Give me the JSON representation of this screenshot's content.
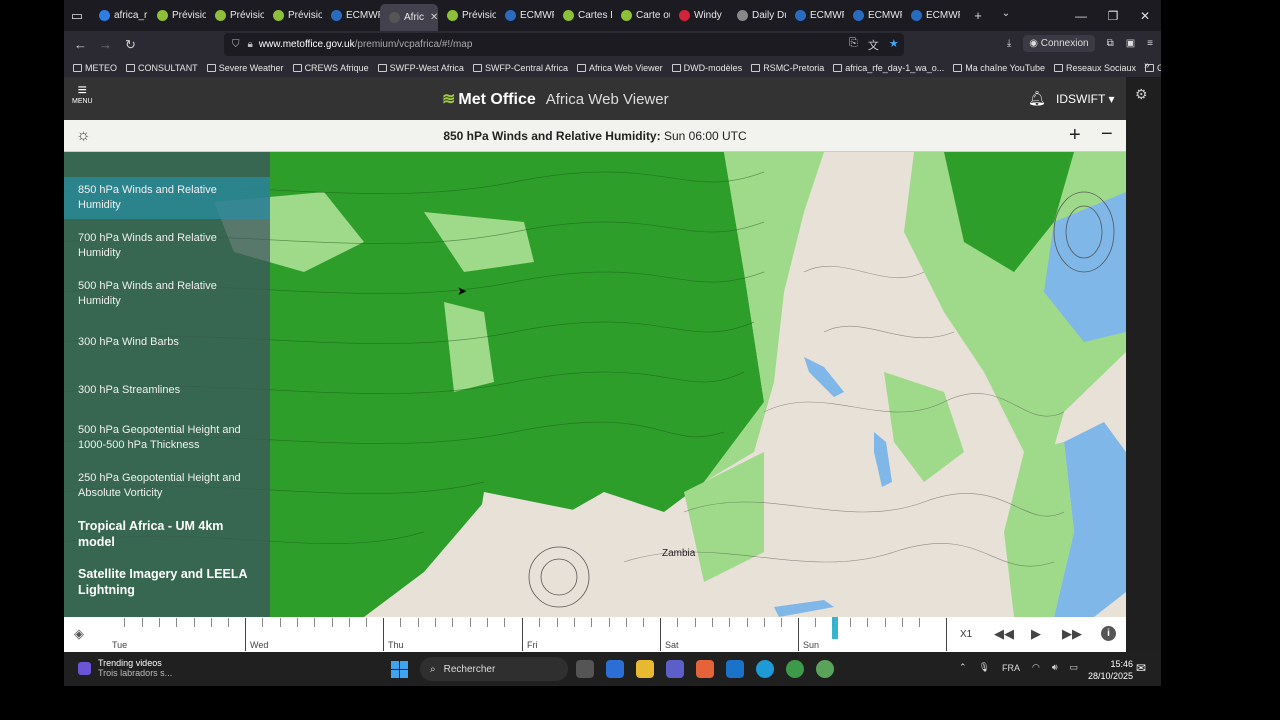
{
  "browser": {
    "tabs": [
      {
        "label": "africa_r",
        "color": "#2e7de0"
      },
      {
        "label": "Prévisio",
        "color": "#8fbf3a"
      },
      {
        "label": "Prévisio",
        "color": "#8fbf3a"
      },
      {
        "label": "Prévisio",
        "color": "#8fbf3a"
      },
      {
        "label": "ECMWF",
        "color": "#2a6bbd"
      },
      {
        "label": "Afric",
        "color": "#555555"
      },
      {
        "label": "Prévisio",
        "color": "#8fbf3a"
      },
      {
        "label": "ECMWF",
        "color": "#2a6bbd"
      },
      {
        "label": "Cartes P",
        "color": "#8fbf3a"
      },
      {
        "label": "Carte ou",
        "color": "#8fbf3a"
      },
      {
        "label": "Windy",
        "color": "#d0243b"
      },
      {
        "label": "Daily Du",
        "color": "#888888"
      },
      {
        "label": "ECMWF",
        "color": "#2a6bbd"
      },
      {
        "label": "ECMWF",
        "color": "#2a6bbd"
      },
      {
        "label": "ECMWF",
        "color": "#2a6bbd"
      }
    ],
    "active_tab_index": 5,
    "url_host": "www.metoffice.gov.uk",
    "url_path": "/premium/vcpafrica/#!/map",
    "account_label": "Connexion",
    "bookmarks": [
      "METEO",
      "CONSULTANT",
      "Severe Weather",
      "CREWS Afrique",
      "SWFP-West Africa",
      "SWFP-Central Africa",
      "Africa Web Viewer",
      "DWD-modèles",
      "RSMC-Pretoria",
      "africa_rfe_day-1_wa_o...",
      "Ma chaîne YouTube",
      "Reseaux Sociaux",
      "Goog Trad"
    ]
  },
  "app": {
    "menu_label": "MENU",
    "brand_name": "Met Office",
    "brand_subtitle": "Africa Web Viewer",
    "user_name": "IDSWIFT",
    "map_title_bold": "850 hPa Winds and Relative Humidity:",
    "map_title_time": "Sun 06:00 UTC",
    "map_place_label": "Zambia"
  },
  "layers": [
    {
      "label": "850 hPa Winds and Relative Humidity",
      "selected": true,
      "section": false
    },
    {
      "label": "700 hPa Winds and Relative Humidity",
      "selected": false,
      "section": false
    },
    {
      "label": "500 hPa Winds and Relative Humidity",
      "selected": false,
      "section": false
    },
    {
      "label": "300 hPa Wind Barbs",
      "selected": false,
      "section": false
    },
    {
      "label": "300 hPa Streamlines",
      "selected": false,
      "section": false
    },
    {
      "label": "500 hPa Geopotential Height and 1000-500 hPa Thickness",
      "selected": false,
      "section": false
    },
    {
      "label": "250 hPa Geopotential Height and Absolute Vorticity",
      "selected": false,
      "section": false
    },
    {
      "label": "Tropical Africa - UM 4km model",
      "selected": false,
      "section": true
    },
    {
      "label": "Satellite Imagery and LEELA Lightning",
      "selected": false,
      "section": true
    }
  ],
  "timeline": {
    "days": [
      "Tue",
      "Wed",
      "Thu",
      "Fri",
      "Sat",
      "Sun"
    ],
    "speed_label": "X1",
    "current_day": "Sun"
  },
  "taskbar": {
    "trending_title": "Trending videos",
    "trending_sub": "Trois labradors s...",
    "search_placeholder": "Rechercher",
    "language": "FRA",
    "time": "15:46",
    "date": "28/10/2025"
  },
  "colors": {
    "map_green_dark": "#2e9e2a",
    "map_green_light": "#9fd98a",
    "map_land": "#e8e1d8",
    "map_water": "#7fb7e8",
    "selected_layer": "#2a8ca0",
    "timeline_marker": "#37b5d0"
  }
}
